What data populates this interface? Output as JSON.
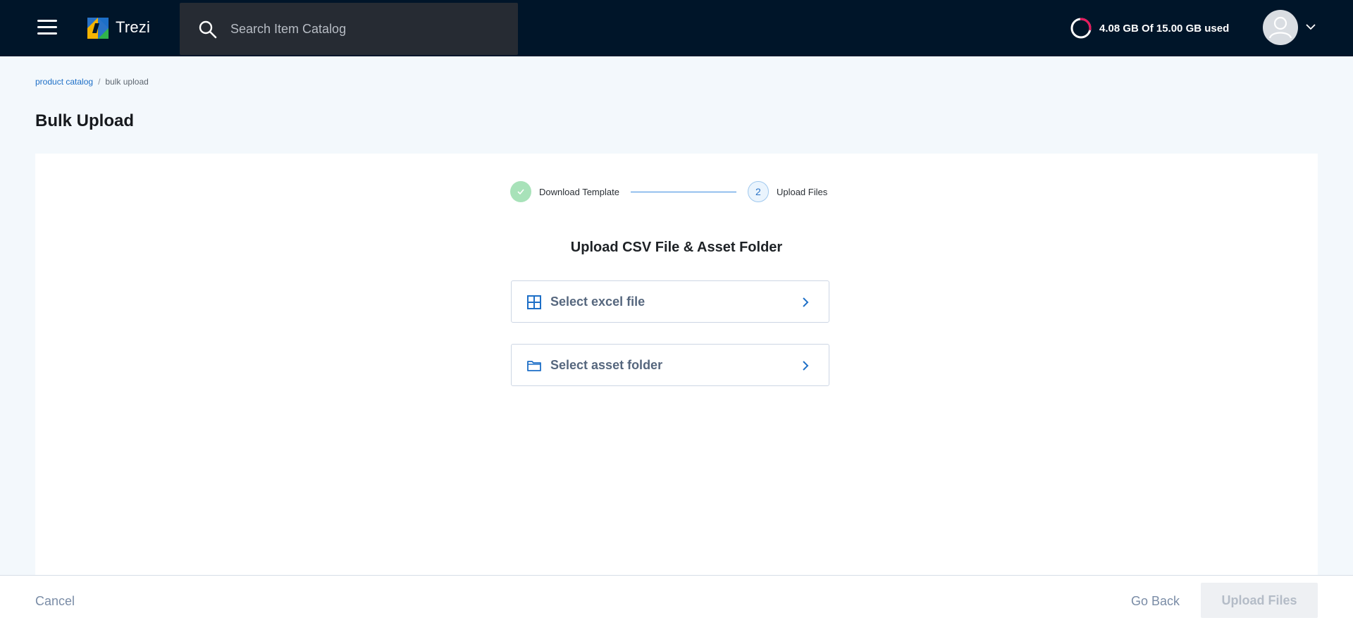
{
  "header": {
    "brand_name": "Trezi",
    "menu_icon": "hamburger-menu-icon",
    "logo_icon": "trezi-logo",
    "search": {
      "placeholder": "Search Item Catalog",
      "value": "",
      "icon": "search-icon"
    },
    "storage": {
      "label": "4.08 GB Of 15.00 GB used",
      "used_gb": 4.08,
      "total_gb": 15.0,
      "ring_color": "#e8185c",
      "icon": "storage-ring-icon"
    },
    "avatar_icon": "user-avatar-icon",
    "avatar_menu_icon": "chevron-down-icon"
  },
  "breadcrumb": {
    "items": [
      {
        "label": "product catalog",
        "link": true
      },
      {
        "label": "bulk upload",
        "link": false
      }
    ],
    "separator": "/"
  },
  "page": {
    "title": "Bulk Upload"
  },
  "stepper": {
    "steps": [
      {
        "label": "Download Template",
        "state": "completed",
        "marker": ""
      },
      {
        "label": "Upload Files",
        "state": "active",
        "marker": "2"
      }
    ],
    "completed_color": "#a8e2b9",
    "active_color": "#2a73c7",
    "line_color": "#3b8ce0"
  },
  "upload": {
    "heading": "Upload CSV File & Asset Folder",
    "excel": {
      "label": "Select excel file",
      "icon": "table-grid-icon"
    },
    "folder": {
      "label": "Select asset folder",
      "icon": "folder-icon"
    },
    "icon_color": "#1d6fc7"
  },
  "footer": {
    "cancel_label": "Cancel",
    "go_back_label": "Go Back",
    "upload_label": "Upload Files",
    "upload_enabled": false
  },
  "colors": {
    "topbar": "#001529",
    "page_bg": "#f3f8fc",
    "link": "#1d6fc7"
  }
}
